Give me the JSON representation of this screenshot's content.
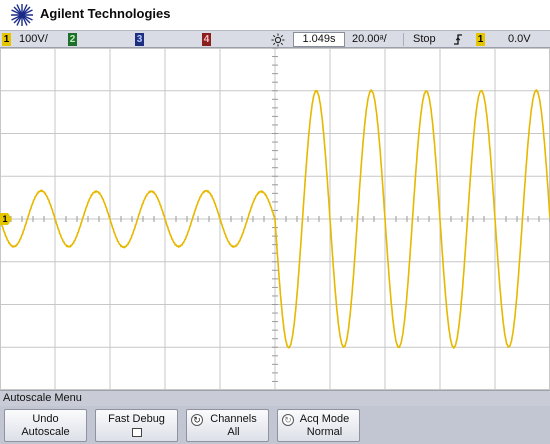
{
  "brand": {
    "name": "Agilent Technologies"
  },
  "status_bar": {
    "channels": [
      {
        "number": "1",
        "value": "100V/",
        "color": "#e5c400",
        "enabled": true
      },
      {
        "number": "2",
        "value": "",
        "color": "#2fa53b",
        "enabled": false
      },
      {
        "number": "3",
        "value": "",
        "color": "#3a5fd6",
        "enabled": false
      },
      {
        "number": "4",
        "value": "",
        "color": "#d83a3a",
        "enabled": false
      }
    ],
    "horizontal_icon": "sun-icon",
    "time_delay": "1.049s",
    "time_scale": "20.00ᵃ/",
    "run_state": "Stop",
    "trigger_edge_icon": "rising-edge-icon",
    "trigger_source": "1",
    "trigger_level": "0.0V"
  },
  "display": {
    "grid_divisions": {
      "horizontal": 10,
      "vertical": 8
    },
    "channel1_marker": "1",
    "trace_color": "#e6b800",
    "waveform": {
      "segments": [
        {
          "cycles": 5,
          "amplitude_divisions": 0.65
        },
        {
          "cycles": 5,
          "amplitude_divisions": 3.0
        }
      ]
    }
  },
  "menu": {
    "title": "Autoscale Menu",
    "softkeys": [
      {
        "line1": "Undo",
        "line2": "Autoscale",
        "icon": ""
      },
      {
        "line1": "Fast Debug",
        "line2": "",
        "icon": "checkbox-icon"
      },
      {
        "line1": "Channels",
        "line2": "All",
        "icon": "rotary-knob-icon"
      },
      {
        "line1": "Acq Mode",
        "line2": "Normal",
        "icon": "rotary-knob-icon"
      }
    ]
  }
}
